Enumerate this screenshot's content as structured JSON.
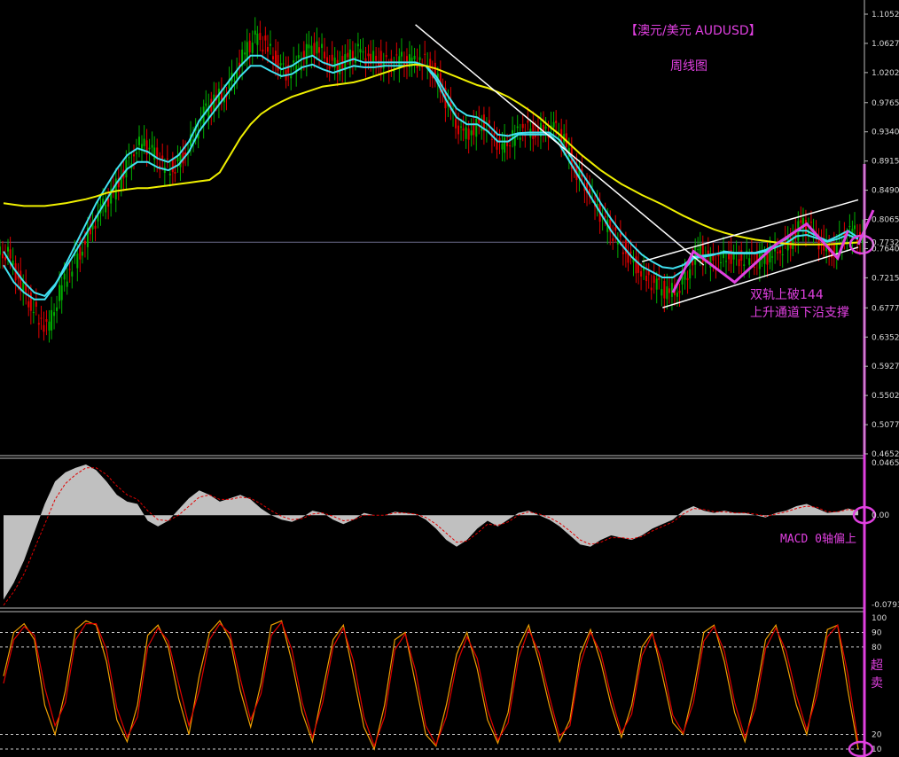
{
  "chart_title": "【澳元/美元 AUDUSD】",
  "chart_subtitle": "周线图",
  "colors": {
    "background": "#000000",
    "bull_candle": "#00b000",
    "bear_candle": "#e00000",
    "ma_cyan_fast": "#40e0f0",
    "ma_cyan_slow": "#40e0f0",
    "ma_yellow_144": "#f0f000",
    "trendline": "#ffffff",
    "annotation": "#e040e0",
    "macd_hist": "#c0c0c0",
    "macd_signal": "#e00000",
    "stoch_main": "#f0a000",
    "stoch_signal": "#e00000",
    "axis_text": "#d8d8d8"
  },
  "annotations": {
    "breakout_line1": "双轨上破144",
    "breakout_line2": "上升通道下沿支撑",
    "macd_note": "MACD 0轴偏上",
    "stoch_note_1": "超",
    "stoch_note_2": "卖"
  },
  "chart_data": [
    {
      "type": "candlestick",
      "panel": "price",
      "price_axis_ticks": [
        "1.10525",
        "1.06275",
        "1.02025",
        "0.97650",
        "0.93400",
        "0.89150",
        "0.84900",
        "0.80650",
        "0.77324",
        "0.76400",
        "0.72150",
        "0.67775",
        "0.63525",
        "0.59275",
        "0.55025",
        "0.50775",
        "0.46525"
      ],
      "current_price_label": "0.77324",
      "ylim": [
        0.46525,
        1.10525
      ],
      "close": [
        0.755,
        0.72,
        0.69,
        0.66,
        0.65,
        0.7,
        0.735,
        0.76,
        0.79,
        0.82,
        0.84,
        0.87,
        0.9,
        0.92,
        0.905,
        0.885,
        0.88,
        0.9,
        0.925,
        0.96,
        0.98,
        0.99,
        1.02,
        1.05,
        1.07,
        1.06,
        1.04,
        1.02,
        1.03,
        1.05,
        1.06,
        1.04,
        1.03,
        1.04,
        1.05,
        1.04,
        1.04,
        1.03,
        1.04,
        1.035,
        1.04,
        1.03,
        1.0,
        0.96,
        0.93,
        0.935,
        0.95,
        0.93,
        0.91,
        0.925,
        0.94,
        0.935,
        0.935,
        0.94,
        0.92,
        0.88,
        0.86,
        0.83,
        0.8,
        0.78,
        0.76,
        0.74,
        0.72,
        0.71,
        0.7,
        0.705,
        0.73,
        0.765,
        0.745,
        0.745,
        0.755,
        0.75,
        0.75,
        0.745,
        0.755,
        0.765,
        0.775,
        0.8,
        0.79,
        0.77,
        0.76,
        0.78,
        0.79,
        0.775
      ],
      "series": [
        {
          "name": "",
          "values": [
            0.74,
            0.715,
            0.7,
            0.69,
            0.69,
            0.71,
            0.74,
            0.77,
            0.8,
            0.83,
            0.855,
            0.88,
            0.9,
            0.91,
            0.905,
            0.895,
            0.89,
            0.9,
            0.92,
            0.95,
            0.97,
            0.99,
            1.01,
            1.03,
            1.045,
            1.045,
            1.035,
            1.025,
            1.03,
            1.04,
            1.045,
            1.035,
            1.03,
            1.035,
            1.04,
            1.035,
            1.035,
            1.035,
            1.035,
            1.035,
            1.035,
            1.03,
            1.01,
            0.98,
            0.955,
            0.945,
            0.945,
            0.935,
            0.92,
            0.92,
            0.93,
            0.93,
            0.93,
            0.93,
            0.915,
            0.89,
            0.865,
            0.84,
            0.815,
            0.79,
            0.77,
            0.752,
            0.738,
            0.73,
            0.722,
            0.722,
            0.732,
            0.75,
            0.752,
            0.755,
            0.76,
            0.758,
            0.758,
            0.758,
            0.762,
            0.77,
            0.778,
            0.79,
            0.79,
            0.782,
            0.775,
            0.782,
            0.79,
            0.78
          ]
        },
        {
          "name": "",
          "values": [
            0.76,
            0.735,
            0.715,
            0.7,
            0.695,
            0.712,
            0.735,
            0.76,
            0.785,
            0.81,
            0.835,
            0.86,
            0.88,
            0.89,
            0.89,
            0.882,
            0.878,
            0.886,
            0.905,
            0.935,
            0.955,
            0.975,
            0.995,
            1.015,
            1.03,
            1.03,
            1.022,
            1.015,
            1.018,
            1.028,
            1.032,
            1.025,
            1.02,
            1.025,
            1.03,
            1.028,
            1.028,
            1.03,
            1.03,
            1.03,
            1.032,
            1.03,
            1.015,
            0.99,
            0.968,
            0.958,
            0.955,
            0.945,
            0.93,
            0.928,
            0.932,
            0.933,
            0.933,
            0.933,
            0.922,
            0.9,
            0.878,
            0.855,
            0.83,
            0.807,
            0.787,
            0.77,
            0.755,
            0.745,
            0.737,
            0.735,
            0.74,
            0.752,
            0.754,
            0.756,
            0.758,
            0.757,
            0.757,
            0.757,
            0.76,
            0.766,
            0.772,
            0.782,
            0.784,
            0.779,
            0.774,
            0.778,
            0.784,
            0.778
          ]
        },
        {
          "name": "",
          "values": [
            0.83,
            0.828,
            0.826,
            0.826,
            0.826,
            0.828,
            0.83,
            0.833,
            0.836,
            0.84,
            0.845,
            0.848,
            0.85,
            0.852,
            0.852,
            0.854,
            0.856,
            0.858,
            0.86,
            0.862,
            0.864,
            0.875,
            0.9,
            0.925,
            0.945,
            0.96,
            0.97,
            0.978,
            0.985,
            0.99,
            0.995,
            1.0,
            1.002,
            1.004,
            1.006,
            1.01,
            1.015,
            1.02,
            1.025,
            1.03,
            1.032,
            1.03,
            1.026,
            1.02,
            1.014,
            1.008,
            1.002,
            0.998,
            0.992,
            0.985,
            0.976,
            0.966,
            0.955,
            0.942,
            0.93,
            0.916,
            0.902,
            0.89,
            0.878,
            0.868,
            0.858,
            0.85,
            0.842,
            0.835,
            0.828,
            0.82,
            0.812,
            0.805,
            0.798,
            0.792,
            0.787,
            0.783,
            0.78,
            0.777,
            0.775,
            0.773,
            0.771,
            0.77,
            0.77,
            0.77,
            0.77,
            0.771,
            0.772,
            0.773
          ]
        }
      ]
    },
    {
      "type": "area",
      "panel": "macd",
      "ylim": [
        -0.07936,
        0.04658
      ],
      "axis_ticks": [
        "0.04658",
        "0.00",
        "-0.07936"
      ],
      "series": [
        {
          "name": "",
          "values": [
            -0.075,
            -0.06,
            -0.04,
            -0.015,
            0.01,
            0.03,
            0.038,
            0.042,
            0.045,
            0.04,
            0.03,
            0.018,
            0.012,
            0.01,
            -0.005,
            -0.01,
            -0.005,
            0.005,
            0.015,
            0.022,
            0.018,
            0.012,
            0.015,
            0.018,
            0.014,
            0.006,
            0.0,
            -0.004,
            -0.006,
            -0.002,
            0.004,
            0.002,
            -0.004,
            -0.008,
            -0.004,
            0.002,
            0.0,
            0.0,
            0.003,
            0.002,
            0.001,
            -0.004,
            -0.012,
            -0.022,
            -0.028,
            -0.022,
            -0.012,
            -0.005,
            -0.01,
            -0.004,
            0.002,
            0.004,
            0.0,
            -0.004,
            -0.01,
            -0.018,
            -0.026,
            -0.028,
            -0.022,
            -0.018,
            -0.02,
            -0.022,
            -0.018,
            -0.012,
            -0.008,
            -0.004,
            0.004,
            0.008,
            0.004,
            0.002,
            0.004,
            0.002,
            0.002,
            0.0,
            -0.002,
            0.002,
            0.004,
            0.008,
            0.01,
            0.006,
            0.002,
            0.003,
            0.006,
            0.004
          ]
        },
        {
          "name": "",
          "values": [
            -0.08,
            -0.068,
            -0.052,
            -0.03,
            -0.008,
            0.014,
            0.028,
            0.036,
            0.042,
            0.042,
            0.036,
            0.026,
            0.018,
            0.014,
            0.004,
            -0.004,
            -0.005,
            0.0,
            0.008,
            0.016,
            0.018,
            0.014,
            0.014,
            0.016,
            0.015,
            0.01,
            0.004,
            -0.001,
            -0.004,
            -0.003,
            0.001,
            0.002,
            -0.001,
            -0.005,
            -0.004,
            0.0,
            0.0,
            0.0,
            0.002,
            0.002,
            0.001,
            -0.002,
            -0.008,
            -0.016,
            -0.024,
            -0.023,
            -0.016,
            -0.008,
            -0.009,
            -0.006,
            0.0,
            0.003,
            0.001,
            -0.002,
            -0.007,
            -0.014,
            -0.022,
            -0.026,
            -0.024,
            -0.02,
            -0.02,
            -0.021,
            -0.019,
            -0.014,
            -0.01,
            -0.006,
            0.001,
            0.006,
            0.005,
            0.003,
            0.003,
            0.002,
            0.002,
            0.001,
            -0.001,
            0.001,
            0.003,
            0.006,
            0.008,
            0.007,
            0.003,
            0.003,
            0.005,
            0.004
          ]
        }
      ]
    },
    {
      "type": "line",
      "panel": "stochastic",
      "ylim": [
        10,
        100
      ],
      "axis_ticks": [
        "100",
        "90",
        "80",
        "20",
        "10"
      ],
      "series": [
        {
          "name": "",
          "values": [
            60,
            90,
            96,
            85,
            40,
            20,
            50,
            92,
            98,
            95,
            70,
            30,
            15,
            40,
            88,
            95,
            80,
            45,
            20,
            60,
            90,
            98,
            85,
            50,
            25,
            55,
            95,
            98,
            70,
            35,
            15,
            50,
            85,
            95,
            60,
            25,
            10,
            40,
            85,
            90,
            55,
            20,
            12,
            40,
            75,
            90,
            65,
            30,
            14,
            35,
            80,
            95,
            70,
            40,
            15,
            30,
            75,
            92,
            70,
            40,
            18,
            40,
            80,
            90,
            60,
            28,
            20,
            50,
            90,
            95,
            70,
            35,
            15,
            45,
            85,
            95,
            70,
            40,
            20,
            55,
            92,
            95,
            50,
            10
          ]
        },
        {
          "name": "",
          "values": [
            55,
            85,
            94,
            88,
            52,
            26,
            42,
            85,
            96,
            96,
            78,
            38,
            18,
            32,
            80,
            93,
            84,
            55,
            26,
            50,
            85,
            96,
            89,
            58,
            30,
            48,
            88,
            97,
            78,
            42,
            18,
            42,
            80,
            93,
            70,
            32,
            12,
            32,
            78,
            89,
            64,
            26,
            13,
            32,
            68,
            87,
            72,
            37,
            16,
            28,
            72,
            92,
            76,
            46,
            19,
            26,
            68,
            90,
            76,
            46,
            21,
            34,
            74,
            89,
            68,
            33,
            21,
            42,
            84,
            94,
            77,
            42,
            18,
            38,
            79,
            93,
            77,
            47,
            23,
            47,
            87,
            95,
            61,
            14
          ]
        }
      ]
    }
  ]
}
